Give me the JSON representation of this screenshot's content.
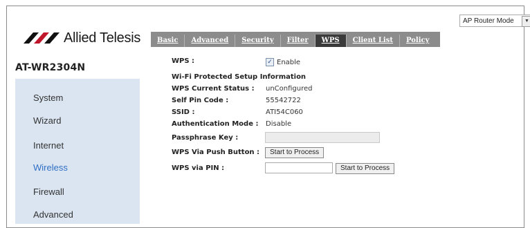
{
  "mode_select": {
    "value": "AP Router Mode"
  },
  "brand": {
    "name": "Allied Telesis",
    "product": "AT-WR2304N"
  },
  "tabs": [
    {
      "label": "Basic"
    },
    {
      "label": "Advanced"
    },
    {
      "label": "Security"
    },
    {
      "label": "Filter"
    },
    {
      "label": "WPS",
      "active": true
    },
    {
      "label": "Client List"
    },
    {
      "label": "Policy"
    }
  ],
  "sidebar": {
    "items": [
      {
        "label": "System"
      },
      {
        "label": "Wizard"
      },
      {
        "label": "Internet"
      },
      {
        "label": "Wireless",
        "active": true
      },
      {
        "label": "Firewall"
      },
      {
        "label": "Advanced"
      }
    ]
  },
  "wps": {
    "wps_label": "WPS :",
    "enable_label": "Enable",
    "enabled": true,
    "info_heading": "Wi-Fi Protected Setup Information",
    "status_label": "WPS Current Status :",
    "status_value": "unConfigured",
    "pin_label": "Self Pin Code :",
    "pin_value": "55542722",
    "ssid_label": "SSID :",
    "ssid_value": "ATI54C060",
    "auth_label": "Authentication Mode :",
    "auth_value": "Disable",
    "passphrase_label": "Passphrase Key :",
    "passphrase_value": "",
    "push_label": "WPS Via Push Button :",
    "push_button": "Start to Process",
    "pin_input_label": "WPS via PIN :",
    "pin_input_value": "",
    "pin_button": "Start to Process"
  },
  "colors": {
    "nav_bg": "#8c8c8c",
    "nav_active": "#3a3a3a",
    "sidebar_bg": "#dae5f1",
    "active_link": "#2f6fc5"
  }
}
